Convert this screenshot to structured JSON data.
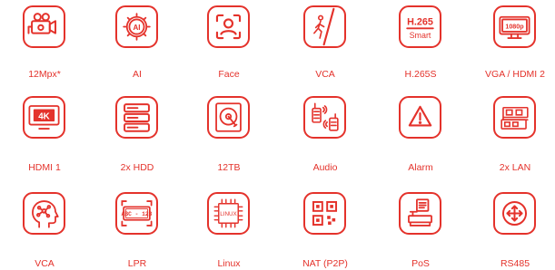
{
  "accent_color": "#e4322b",
  "tiles": [
    {
      "label": "12Mpx*",
      "icon": "cctv-camera-icon"
    },
    {
      "label": "AI",
      "icon": "ai-chip-icon"
    },
    {
      "label": "Face",
      "icon": "face-recognition-icon"
    },
    {
      "label": "VCA",
      "icon": "tripwire-intruder-icon"
    },
    {
      "label": "H.265S",
      "icon": "h265-smart-icon",
      "text_line1": "H.265",
      "text_line2": "Smart"
    },
    {
      "label": "VGA / HDMI 2",
      "icon": "monitor-1080p-icon",
      "text_line1": "1080p"
    },
    {
      "label": "HDMI 1",
      "icon": "monitor-4k-icon",
      "text_line1": "4K"
    },
    {
      "label": "2x HDD",
      "icon": "server-stack-icon"
    },
    {
      "label": "12TB",
      "icon": "hard-drive-icon"
    },
    {
      "label": "Audio",
      "icon": "two-way-radio-icon"
    },
    {
      "label": "Alarm",
      "icon": "alarm-warning-icon"
    },
    {
      "label": "2x LAN",
      "icon": "network-card-icon"
    },
    {
      "label": "VCA",
      "icon": "brain-network-icon"
    },
    {
      "label": "LPR",
      "icon": "license-plate-icon",
      "text_line1": "ABC - 123"
    },
    {
      "label": "Linux",
      "icon": "linux-chip-icon",
      "text_line1": "LINUX"
    },
    {
      "label": "NAT (P2P)",
      "icon": "qr-code-icon"
    },
    {
      "label": "PoS",
      "icon": "point-of-sale-icon"
    },
    {
      "label": "RS485",
      "icon": "four-way-arrows-icon"
    }
  ]
}
